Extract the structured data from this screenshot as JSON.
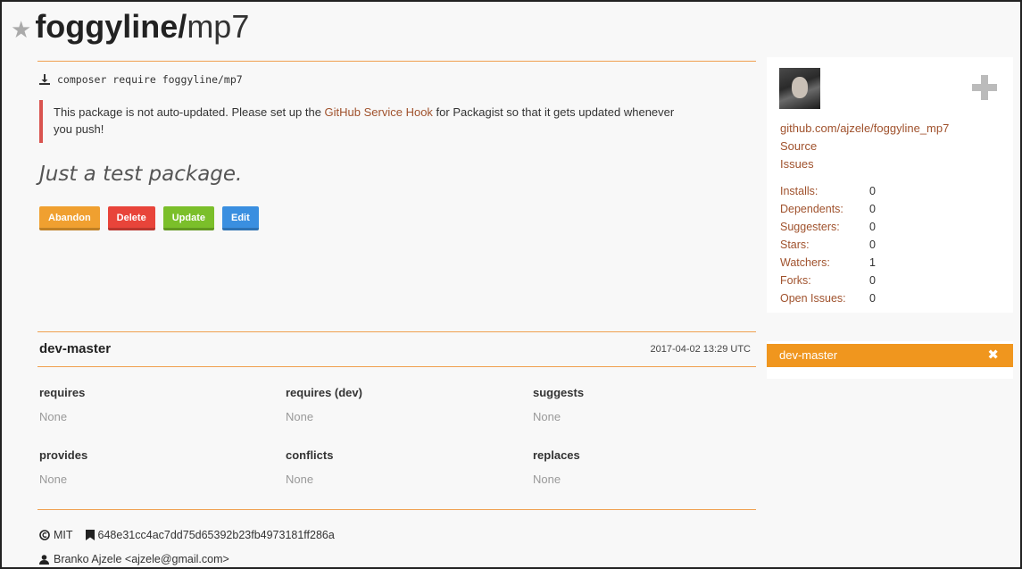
{
  "header": {
    "vendor": "foggyline/",
    "package": "mp7"
  },
  "install": {
    "command": "composer require foggyline/mp7"
  },
  "notice": {
    "text_before": "This package is not auto-updated. Please set up the ",
    "link": "GitHub Service Hook",
    "text_after": " for Packagist so that it gets updated whenever you push!"
  },
  "description": "Just a test package.",
  "buttons": {
    "abandon": "Abandon",
    "delete": "Delete",
    "update": "Update",
    "edit": "Edit"
  },
  "version": {
    "name": "dev-master",
    "date": "2017-04-02 13:29 UTC"
  },
  "links": {
    "requires": {
      "label": "requires",
      "value": "None"
    },
    "requires_dev": {
      "label": "requires (dev)",
      "value": "None"
    },
    "suggests": {
      "label": "suggests",
      "value": "None"
    },
    "provides": {
      "label": "provides",
      "value": "None"
    },
    "conflicts": {
      "label": "conflicts",
      "value": "None"
    },
    "replaces": {
      "label": "replaces",
      "value": "None"
    }
  },
  "footer": {
    "license": "MIT",
    "reference": "648e31cc4ac7dd75d65392b23fb4973181ff286a",
    "author": "Branko Ajzele <ajzele@gmail.com>"
  },
  "sidebar": {
    "repo": "github.com/ajzele/foggyline_mp7",
    "source": "Source",
    "issues": "Issues",
    "stats": [
      {
        "label": "Installs:",
        "value": "0"
      },
      {
        "label": "Dependents:",
        "value": "0"
      },
      {
        "label": "Suggesters:",
        "value": "0"
      },
      {
        "label": "Stars:",
        "value": "0"
      },
      {
        "label": "Watchers:",
        "value": "1"
      },
      {
        "label": "Forks:",
        "value": "0"
      },
      {
        "label": "Open Issues:",
        "value": "0"
      }
    ]
  },
  "branch": {
    "name": "dev-master"
  },
  "icons": {
    "star": "star-icon",
    "download": "download-icon",
    "plus": "plus-icon",
    "close": "close-icon",
    "license": "copyright-icon",
    "bookmark": "bookmark-icon",
    "user": "user-icon"
  },
  "colors": {
    "accent": "#f0961e",
    "link": "#a0522d",
    "abandon": "#f0a030",
    "delete": "#e8443a",
    "update": "#7bbf2a",
    "edit": "#3a8fe0",
    "notice_border": "#d9534f"
  }
}
